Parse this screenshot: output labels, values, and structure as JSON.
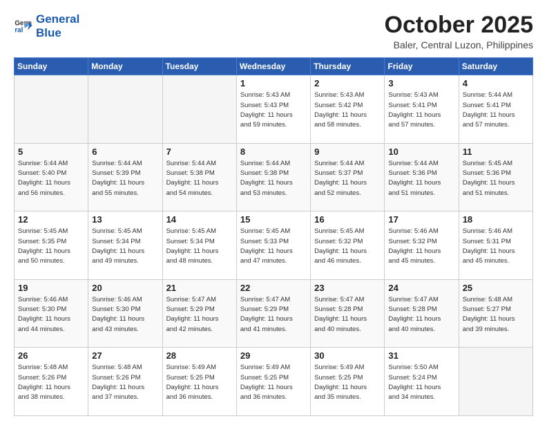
{
  "header": {
    "logo_line1": "General",
    "logo_line2": "Blue",
    "month": "October 2025",
    "location": "Baler, Central Luzon, Philippines"
  },
  "weekdays": [
    "Sunday",
    "Monday",
    "Tuesday",
    "Wednesday",
    "Thursday",
    "Friday",
    "Saturday"
  ],
  "weeks": [
    [
      {
        "day": "",
        "info": ""
      },
      {
        "day": "",
        "info": ""
      },
      {
        "day": "",
        "info": ""
      },
      {
        "day": "1",
        "info": "Sunrise: 5:43 AM\nSunset: 5:43 PM\nDaylight: 11 hours\nand 59 minutes."
      },
      {
        "day": "2",
        "info": "Sunrise: 5:43 AM\nSunset: 5:42 PM\nDaylight: 11 hours\nand 58 minutes."
      },
      {
        "day": "3",
        "info": "Sunrise: 5:43 AM\nSunset: 5:41 PM\nDaylight: 11 hours\nand 57 minutes."
      },
      {
        "day": "4",
        "info": "Sunrise: 5:44 AM\nSunset: 5:41 PM\nDaylight: 11 hours\nand 57 minutes."
      }
    ],
    [
      {
        "day": "5",
        "info": "Sunrise: 5:44 AM\nSunset: 5:40 PM\nDaylight: 11 hours\nand 56 minutes."
      },
      {
        "day": "6",
        "info": "Sunrise: 5:44 AM\nSunset: 5:39 PM\nDaylight: 11 hours\nand 55 minutes."
      },
      {
        "day": "7",
        "info": "Sunrise: 5:44 AM\nSunset: 5:38 PM\nDaylight: 11 hours\nand 54 minutes."
      },
      {
        "day": "8",
        "info": "Sunrise: 5:44 AM\nSunset: 5:38 PM\nDaylight: 11 hours\nand 53 minutes."
      },
      {
        "day": "9",
        "info": "Sunrise: 5:44 AM\nSunset: 5:37 PM\nDaylight: 11 hours\nand 52 minutes."
      },
      {
        "day": "10",
        "info": "Sunrise: 5:44 AM\nSunset: 5:36 PM\nDaylight: 11 hours\nand 51 minutes."
      },
      {
        "day": "11",
        "info": "Sunrise: 5:45 AM\nSunset: 5:36 PM\nDaylight: 11 hours\nand 51 minutes."
      }
    ],
    [
      {
        "day": "12",
        "info": "Sunrise: 5:45 AM\nSunset: 5:35 PM\nDaylight: 11 hours\nand 50 minutes."
      },
      {
        "day": "13",
        "info": "Sunrise: 5:45 AM\nSunset: 5:34 PM\nDaylight: 11 hours\nand 49 minutes."
      },
      {
        "day": "14",
        "info": "Sunrise: 5:45 AM\nSunset: 5:34 PM\nDaylight: 11 hours\nand 48 minutes."
      },
      {
        "day": "15",
        "info": "Sunrise: 5:45 AM\nSunset: 5:33 PM\nDaylight: 11 hours\nand 47 minutes."
      },
      {
        "day": "16",
        "info": "Sunrise: 5:45 AM\nSunset: 5:32 PM\nDaylight: 11 hours\nand 46 minutes."
      },
      {
        "day": "17",
        "info": "Sunrise: 5:46 AM\nSunset: 5:32 PM\nDaylight: 11 hours\nand 45 minutes."
      },
      {
        "day": "18",
        "info": "Sunrise: 5:46 AM\nSunset: 5:31 PM\nDaylight: 11 hours\nand 45 minutes."
      }
    ],
    [
      {
        "day": "19",
        "info": "Sunrise: 5:46 AM\nSunset: 5:30 PM\nDaylight: 11 hours\nand 44 minutes."
      },
      {
        "day": "20",
        "info": "Sunrise: 5:46 AM\nSunset: 5:30 PM\nDaylight: 11 hours\nand 43 minutes."
      },
      {
        "day": "21",
        "info": "Sunrise: 5:47 AM\nSunset: 5:29 PM\nDaylight: 11 hours\nand 42 minutes."
      },
      {
        "day": "22",
        "info": "Sunrise: 5:47 AM\nSunset: 5:29 PM\nDaylight: 11 hours\nand 41 minutes."
      },
      {
        "day": "23",
        "info": "Sunrise: 5:47 AM\nSunset: 5:28 PM\nDaylight: 11 hours\nand 40 minutes."
      },
      {
        "day": "24",
        "info": "Sunrise: 5:47 AM\nSunset: 5:28 PM\nDaylight: 11 hours\nand 40 minutes."
      },
      {
        "day": "25",
        "info": "Sunrise: 5:48 AM\nSunset: 5:27 PM\nDaylight: 11 hours\nand 39 minutes."
      }
    ],
    [
      {
        "day": "26",
        "info": "Sunrise: 5:48 AM\nSunset: 5:26 PM\nDaylight: 11 hours\nand 38 minutes."
      },
      {
        "day": "27",
        "info": "Sunrise: 5:48 AM\nSunset: 5:26 PM\nDaylight: 11 hours\nand 37 minutes."
      },
      {
        "day": "28",
        "info": "Sunrise: 5:49 AM\nSunset: 5:25 PM\nDaylight: 11 hours\nand 36 minutes."
      },
      {
        "day": "29",
        "info": "Sunrise: 5:49 AM\nSunset: 5:25 PM\nDaylight: 11 hours\nand 36 minutes."
      },
      {
        "day": "30",
        "info": "Sunrise: 5:49 AM\nSunset: 5:25 PM\nDaylight: 11 hours\nand 35 minutes."
      },
      {
        "day": "31",
        "info": "Sunrise: 5:50 AM\nSunset: 5:24 PM\nDaylight: 11 hours\nand 34 minutes."
      },
      {
        "day": "",
        "info": ""
      }
    ]
  ]
}
